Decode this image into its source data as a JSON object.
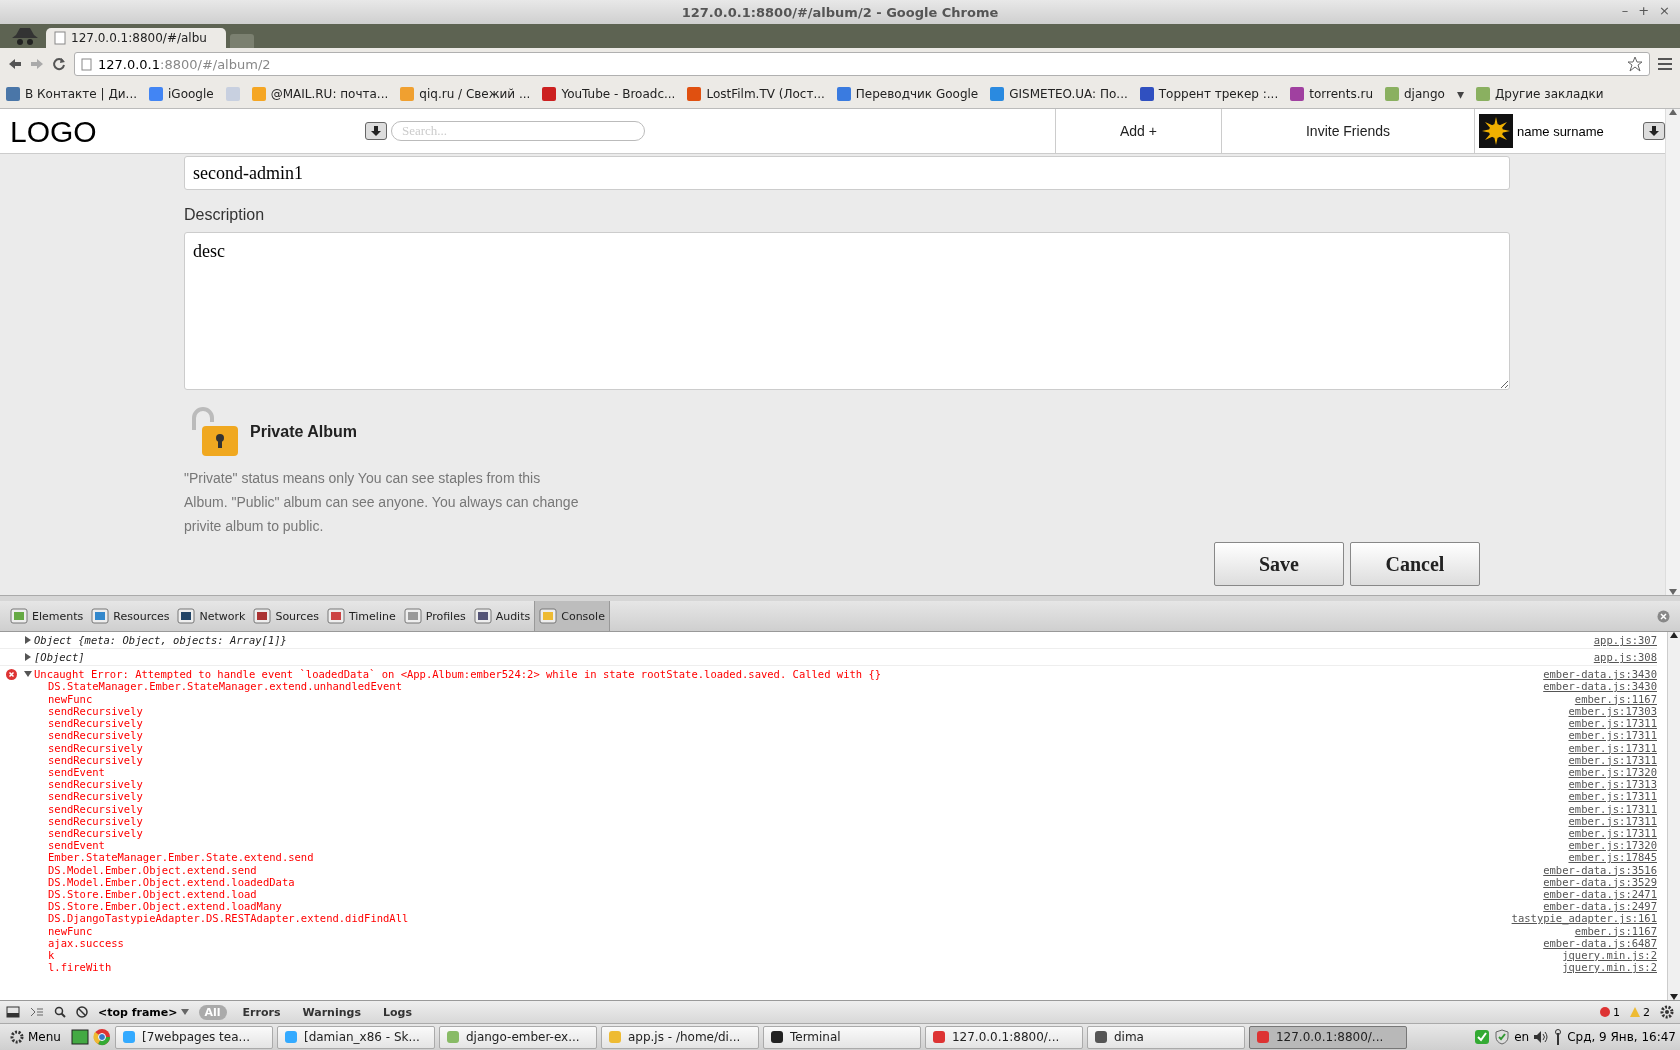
{
  "window": {
    "title": "127.0.0.1:8800/#/album/2 - Google Chrome",
    "controls": [
      "–",
      "+",
      "×"
    ]
  },
  "tabs": [
    {
      "label": "127.0.0.1:8800/#/albu",
      "selected": true
    }
  ],
  "address": {
    "host": "127.0.0.1",
    "path": ":8800/#/album/2"
  },
  "bookmarks": [
    {
      "label": "В Контакте | Ди...",
      "color": "#4a76a8"
    },
    {
      "label": "iGoogle",
      "color": "#4285f4"
    },
    {
      "color": "#c8d0e0"
    },
    {
      "label": "@MAIL.RU: почта...",
      "color": "#f5a623"
    },
    {
      "label": "qiq.ru / Свежий ...",
      "color": "#f0a030"
    },
    {
      "label": "YouTube - Broadc...",
      "color": "#cc2020"
    },
    {
      "label": "LostFilm.TV (Лост...",
      "color": "#e05010"
    },
    {
      "label": "Переводчик Google",
      "color": "#3a7be0"
    },
    {
      "label": "GISMETEO.UA: По...",
      "color": "#2a8ae0"
    },
    {
      "label": "Торрент трекер :...",
      "color": "#3050c0"
    },
    {
      "label": "torrents.ru",
      "color": "#a040a0"
    },
    {
      "label": "django",
      "color": "#8ab060"
    },
    {
      "label": "Другие закладки",
      "color": "#8ab060"
    }
  ],
  "bookmarks_overflow": "▾",
  "app_header": {
    "logo": "LOGO",
    "search": {
      "placeholder": "Search..."
    },
    "nav": [
      "Add +",
      "Invite Friends"
    ],
    "user": "name surname"
  },
  "form": {
    "name_value": "second-admin1",
    "description_label": "Description",
    "description_value": "desc",
    "privacy": {
      "label": "Private Album",
      "private": true,
      "hint": "\"Private\" status means only You can see staples from this Album. \"Public\" album can see anyone. You always can change privite album to public."
    },
    "buttons": [
      "Save",
      "Cancel"
    ]
  },
  "devtools": {
    "tabs": [
      {
        "label": "Elements",
        "selected": false
      },
      {
        "label": "Resources",
        "selected": false
      },
      {
        "label": "Network",
        "selected": false
      },
      {
        "label": "Sources",
        "selected": false
      },
      {
        "label": "Timeline",
        "selected": false
      },
      {
        "label": "Profiles",
        "selected": false
      },
      {
        "label": "Audits",
        "selected": false
      },
      {
        "label": "Console",
        "selected": true
      }
    ],
    "console": [
      {
        "kind": "log",
        "expanded": false,
        "text": "Object {meta: Object, objects: Array[1]}",
        "source": "app.js:307"
      },
      {
        "kind": "log",
        "expanded": false,
        "text": "[Object]",
        "source": "app.js:308"
      },
      {
        "kind": "error",
        "expanded": true,
        "text": "Uncaught Error: Attempted to handle event `loadedData` on <App.Album:ember524:2> while in state rootState.loaded.saved. Called with {}",
        "source": "ember-data.js:3430",
        "stack": [
          {
            "fn": "DS.StateManager.Ember.StateManager.extend.unhandledEvent",
            "source": "ember-data.js:3430"
          },
          {
            "fn": "newFunc",
            "source": "ember.js:1167"
          },
          {
            "fn": "sendRecursively",
            "source": "ember.js:17303"
          },
          {
            "fn": "sendRecursively",
            "source": "ember.js:17311"
          },
          {
            "fn": "sendRecursively",
            "source": "ember.js:17311"
          },
          {
            "fn": "sendRecursively",
            "source": "ember.js:17311"
          },
          {
            "fn": "sendRecursively",
            "source": "ember.js:17311"
          },
          {
            "fn": "sendEvent",
            "source": "ember.js:17320"
          },
          {
            "fn": "sendRecursively",
            "source": "ember.js:17313"
          },
          {
            "fn": "sendRecursively",
            "source": "ember.js:17311"
          },
          {
            "fn": "sendRecursively",
            "source": "ember.js:17311"
          },
          {
            "fn": "sendRecursively",
            "source": "ember.js:17311"
          },
          {
            "fn": "sendRecursively",
            "source": "ember.js:17311"
          },
          {
            "fn": "sendEvent",
            "source": "ember.js:17320"
          },
          {
            "fn": "Ember.StateManager.Ember.State.extend.send",
            "source": "ember.js:17845"
          },
          {
            "fn": "DS.Model.Ember.Object.extend.send",
            "source": "ember-data.js:3516"
          },
          {
            "fn": "DS.Model.Ember.Object.extend.loadedData",
            "source": "ember-data.js:3529"
          },
          {
            "fn": "DS.Store.Ember.Object.extend.load",
            "source": "ember-data.js:2471"
          },
          {
            "fn": "DS.Store.Ember.Object.extend.loadMany",
            "source": "ember-data.js:2497"
          },
          {
            "fn": "DS.DjangoTastypieAdapter.DS.RESTAdapter.extend.didFindAll",
            "source": "tastypie_adapter.js:161"
          },
          {
            "fn": "newFunc",
            "source": "ember.js:1167"
          },
          {
            "fn": "ajax.success",
            "source": "ember-data.js:6487"
          },
          {
            "fn": "k",
            "source": "jquery.min.js:2"
          },
          {
            "fn": "l.fireWith",
            "source": "jquery.min.js:2"
          }
        ]
      }
    ],
    "bottom": {
      "frame": "<top frame>",
      "filters": [
        {
          "label": "All",
          "selected": true
        },
        {
          "label": "Errors",
          "selected": false
        },
        {
          "label": "Warnings",
          "selected": false
        },
        {
          "label": "Logs",
          "selected": false
        }
      ],
      "errors": "1",
      "warnings": "2"
    }
  },
  "taskbar": {
    "menu": "Menu",
    "items": [
      {
        "label": "[7webpages tea...",
        "selected": false
      },
      {
        "label": "[damian_x86 - Sk...",
        "selected": false
      },
      {
        "label": "django-ember-ex...",
        "selected": false
      },
      {
        "label": "app.js - /home/di...",
        "selected": false
      },
      {
        "label": "Terminal",
        "selected": false
      },
      {
        "label": "127.0.0.1:8800/...",
        "selected": false
      },
      {
        "label": "dima",
        "selected": false
      },
      {
        "label": "127.0.0.1:8800/...",
        "selected": true
      }
    ],
    "lang": "en",
    "clock": "Срд,  9 Янв, 16:47"
  }
}
